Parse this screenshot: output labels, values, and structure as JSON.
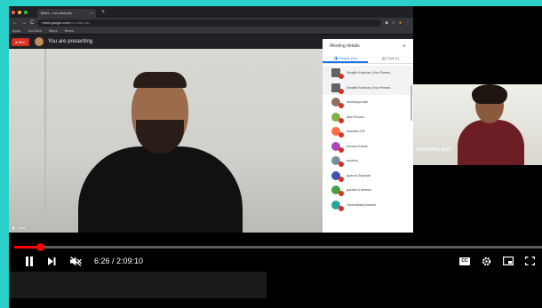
{
  "browser": {
    "tab_title": "Meet – nvr-zfad-ydc",
    "tab_close": "×",
    "new_tab": "+",
    "url_host": "meet.google.com",
    "url_path": "/nvr-zfad-ydc",
    "bookmarks": [
      "Apps",
      "YouTube",
      "Maps",
      "News"
    ]
  },
  "meet": {
    "rec_label": "● REC",
    "presenting_text": "You are presenting",
    "main_label": "You"
  },
  "panel": {
    "title": "Meeting details",
    "close": "×",
    "tab_people": "People (20)",
    "tab_chat": "Chat (1)",
    "participants": [
      {
        "name": "Sreejith Krishnan (Your Presen...",
        "color": "#5f6368",
        "present": true
      },
      {
        "name": "Sreejith Krishnan (Your Presen...",
        "color": "#5f6368",
        "present": true
      },
      {
        "name": "Aishwarya Nair",
        "color": "#8d6e63",
        "present": false
      },
      {
        "name": "Alan Bruuza",
        "color": "#7cb342",
        "present": false
      },
      {
        "name": "Anandhu KR",
        "color": "#ff7043",
        "present": false
      },
      {
        "name": "Anusha Kamal",
        "color": "#ab47bc",
        "present": false
      },
      {
        "name": "anudevr",
        "color": "#78909c",
        "present": false
      },
      {
        "name": "Aparna Gopinath",
        "color": "#3f51b5",
        "present": false
      },
      {
        "name": "gokhan d ramesh",
        "color": "#43a047",
        "present": false
      },
      {
        "name": "Harshadutta Anandh",
        "color": "#26a69a",
        "present": false
      }
    ]
  },
  "second_video": {
    "label": "mamadha arch"
  },
  "player": {
    "time_text": "6:26 / 2:09:10",
    "progress_fraction": 0.049,
    "cc_label": "CC"
  },
  "colors": {
    "accent": "#1a73e8",
    "progress": "#ff0000",
    "background": "#2ad1c9"
  }
}
